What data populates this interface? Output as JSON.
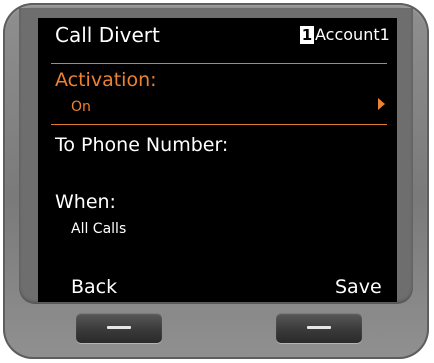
{
  "header": {
    "title": "Call Divert",
    "account_number": "1",
    "account_name": "Account1"
  },
  "menu": {
    "activation": {
      "label": "Activation:",
      "value": "On"
    },
    "phone_number": {
      "label": "To Phone Number:",
      "value": ""
    },
    "when": {
      "label": "When:",
      "value": "All Calls"
    }
  },
  "softkeys": {
    "left": "Back",
    "right": "Save"
  },
  "colors": {
    "accent": "#ec8232",
    "screen_background": "#000000",
    "device_body": "#808080"
  }
}
